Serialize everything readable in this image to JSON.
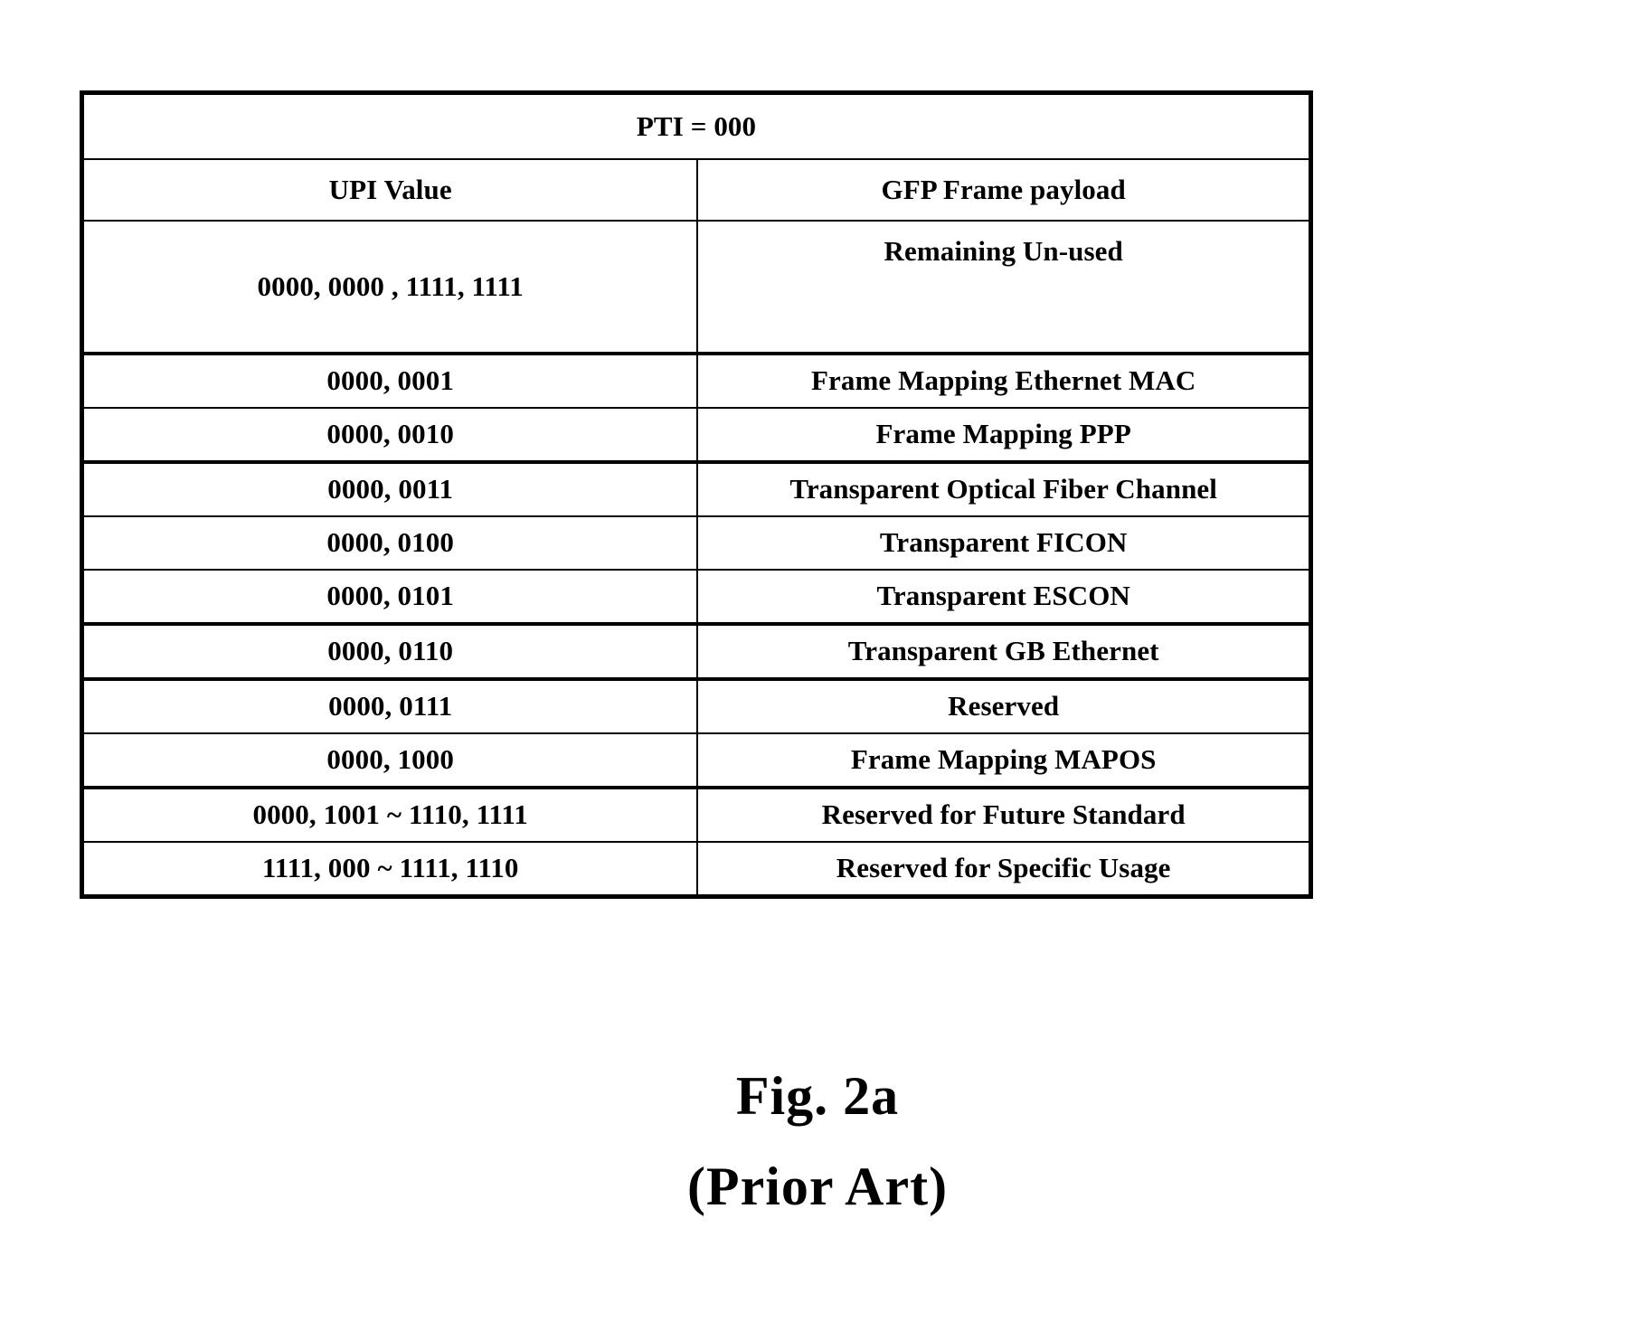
{
  "figure": {
    "label": "Fig. 2a",
    "note": "(Prior Art)"
  },
  "table": {
    "title": "PTI = 000",
    "columns": [
      "UPI Value",
      "GFP Frame payload"
    ],
    "rows": [
      {
        "upi": "0000, 0000  , 1111, 1111",
        "payload": "Remaining Un-used"
      },
      {
        "upi": "0000, 0001",
        "payload": "Frame Mapping Ethernet MAC"
      },
      {
        "upi": "0000, 0010",
        "payload": "Frame Mapping PPP"
      },
      {
        "upi": "0000, 0011",
        "payload": "Transparent Optical Fiber Channel"
      },
      {
        "upi": "0000, 0100",
        "payload": "Transparent FICON"
      },
      {
        "upi": "0000, 0101",
        "payload": "Transparent ESCON"
      },
      {
        "upi": "0000, 0110",
        "payload": "Transparent GB Ethernet"
      },
      {
        "upi": "0000, 0111",
        "payload": "Reserved"
      },
      {
        "upi": "0000, 1000",
        "payload": "Frame Mapping MAPOS"
      },
      {
        "upi": "0000, 1001 ~ 1110, 1111",
        "payload": "Reserved for Future Standard"
      },
      {
        "upi": "1111, 000 ~ 1111, 1110",
        "payload": "Reserved for Specific Usage"
      }
    ]
  },
  "colors": {
    "ink": "#000000",
    "paper": "#ffffff"
  }
}
